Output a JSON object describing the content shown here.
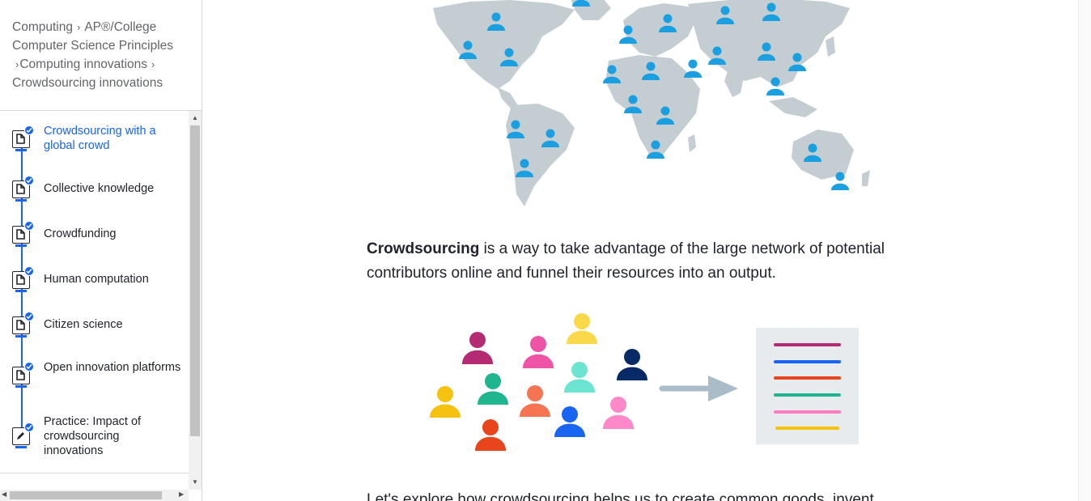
{
  "breadcrumb": {
    "c1": "Computing",
    "c2": "AP®︎/College Computer Science Principles",
    "c3": "Computing innovations",
    "c4": "Crowdsourcing innovations",
    "sep": "›"
  },
  "sidebar": {
    "items": [
      {
        "label": "Crowdsourcing with a global crowd",
        "type": "article",
        "active": true
      },
      {
        "label": "Collective knowledge",
        "type": "article"
      },
      {
        "label": "Crowdfunding",
        "type": "article"
      },
      {
        "label": "Human computation",
        "type": "article"
      },
      {
        "label": "Citizen science",
        "type": "article"
      },
      {
        "label": "Open innovation platforms",
        "type": "article"
      },
      {
        "label": "Practice: Impact of crowdsourcing innovations",
        "type": "exercise"
      }
    ]
  },
  "content": {
    "para1_bold": "Crowdsourcing",
    "para1_rest": " is a way to take advantage of the large network of potential contributors online and funnel their resources into an output.",
    "para2": "Let's explore how crowdsourcing helps us to create common goods, invent"
  },
  "colors": {
    "accent": "#1865f2",
    "map_land": "#c4cdd2",
    "person_map": "#1a9fe0",
    "arrow": "#a9bcc8",
    "doc_bg": "#e8ebee",
    "people": [
      "#b52b73",
      "#ee53a6",
      "#f9d94a",
      "#082b67",
      "#1fb58f",
      "#6be5d1",
      "#f5c20f",
      "#f77452",
      "#1865f2",
      "#ff88c8",
      "#e8451d"
    ],
    "doc_lines": [
      "#b52b73",
      "#1865f2",
      "#e8451d",
      "#1fb58f",
      "#ff7cbf",
      "#f5c20f"
    ]
  }
}
